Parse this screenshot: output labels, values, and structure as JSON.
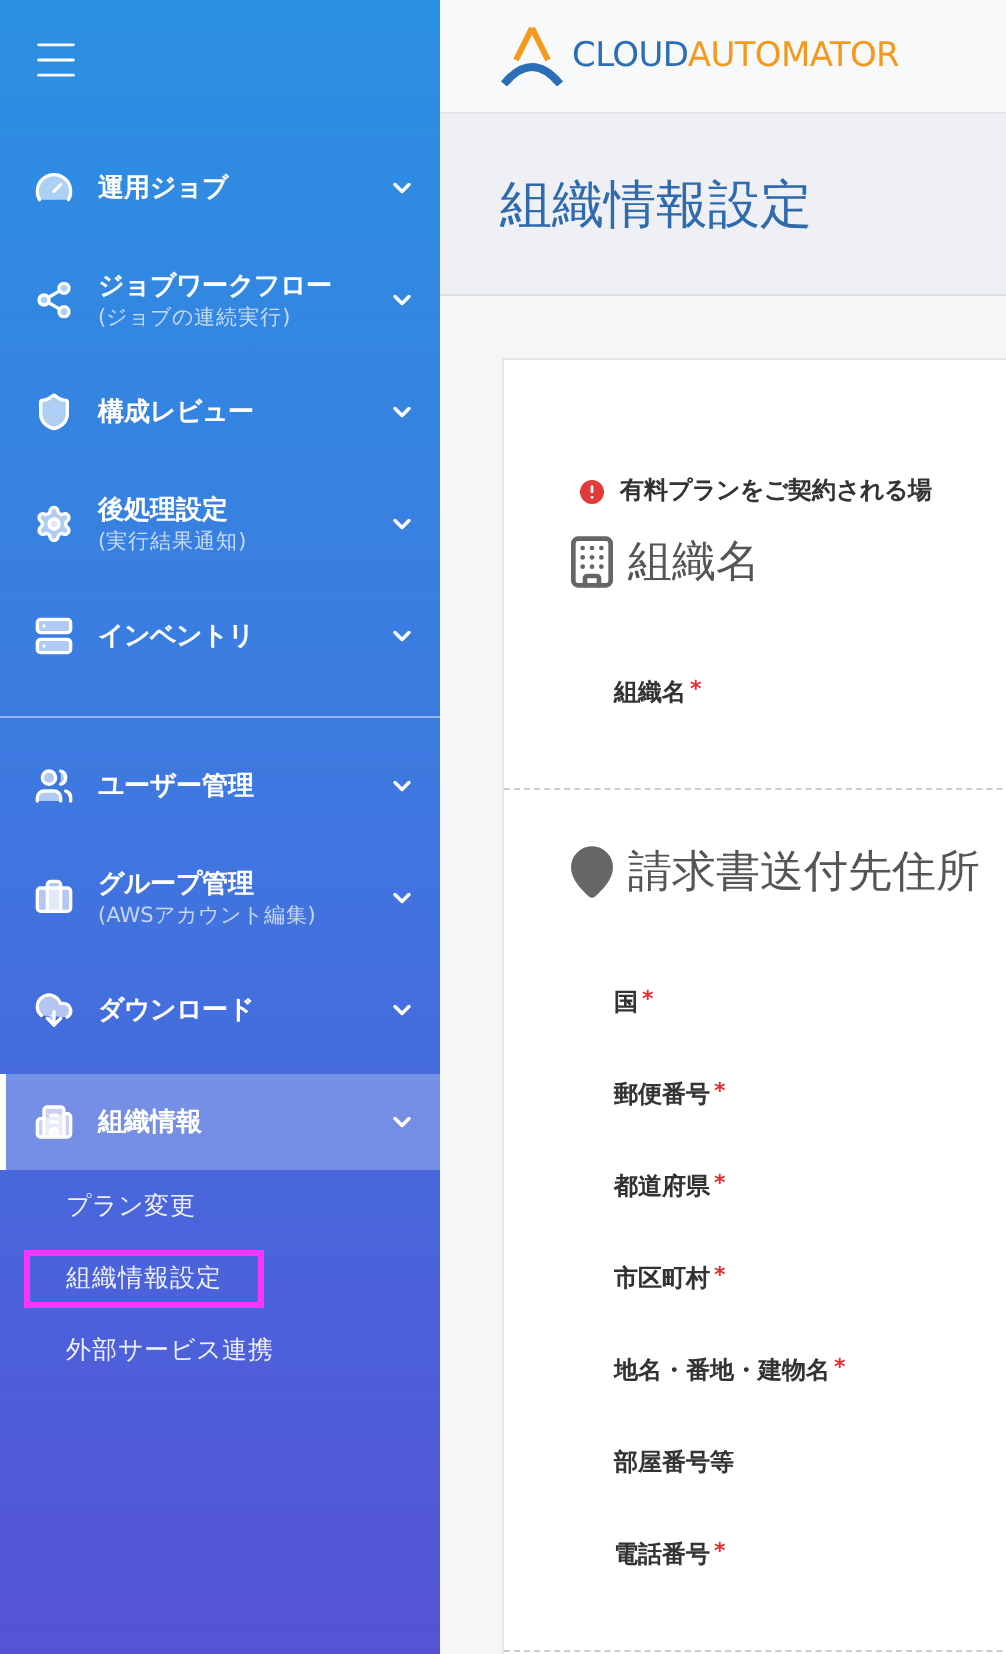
{
  "sidebar": {
    "groups": [
      {
        "items": [
          {
            "label": "運用ジョブ",
            "selected": false
          },
          {
            "label": "ジョブワークフロー",
            "sublabel": "(ジョブの連続実行)",
            "selected": false
          },
          {
            "label": "構成レビュー",
            "selected": false
          },
          {
            "label": "後処理設定",
            "sublabel": "(実行結果通知)",
            "selected": false
          },
          {
            "label": "インベントリ",
            "selected": false
          }
        ]
      },
      {
        "items": [
          {
            "label": "ユーザー管理",
            "selected": false
          },
          {
            "label": "グループ管理",
            "sublabel": "(AWSアカウント編集)",
            "selected": false
          },
          {
            "label": "ダウンロード",
            "selected": false
          },
          {
            "label": "組織情報",
            "selected": true,
            "children": [
              {
                "label": "プラン変更",
                "selected": false
              },
              {
                "label": "組織情報設定",
                "selected": true
              },
              {
                "label": "外部サービス連携",
                "selected": false
              }
            ]
          }
        ]
      }
    ]
  },
  "header": {
    "logo": {
      "part_1": "CLOUD",
      "part_2": "AUTOMATOR"
    }
  },
  "page_title": "組織情報設定",
  "alert": "有料プランをご契約される場",
  "sections": [
    {
      "title": "組織名",
      "fields": [
        {
          "label": "組織名",
          "required_mark": "*"
        }
      ]
    },
    {
      "title": "請求書送付先住所",
      "fields": [
        {
          "label": "国",
          "required_mark": "*"
        },
        {
          "label": "郵便番号",
          "required_mark": "*"
        },
        {
          "label": "都道府県",
          "required_mark": "*"
        },
        {
          "label": "市区町村",
          "required_mark": "*"
        },
        {
          "label": "地名・番地・建物名",
          "required_mark": "*"
        },
        {
          "label": "部屋番号等"
        },
        {
          "label": "電話番号",
          "required_mark": "*"
        }
      ]
    }
  ]
}
